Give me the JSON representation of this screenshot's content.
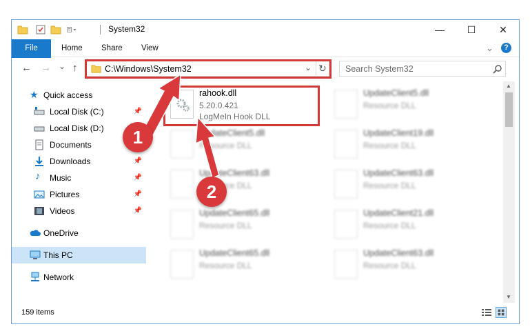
{
  "window": {
    "title": "System32",
    "minimize": "—",
    "maximize": "☐",
    "close": "✕"
  },
  "ribbon": {
    "tabs": [
      "File",
      "Home",
      "Share",
      "View"
    ],
    "help": "?",
    "collapse": "⌄"
  },
  "nav": {
    "back": "←",
    "forward": "→",
    "dropdown": "⌄",
    "up": "↑"
  },
  "address": {
    "path": "C:\\Windows\\System32",
    "dropdown": "⌄",
    "refresh": "↻"
  },
  "search": {
    "placeholder": "Search System32",
    "icon": "search-icon"
  },
  "sidebar": {
    "items": [
      {
        "label": "Quick access",
        "icon": "star-icon",
        "pinned": false
      },
      {
        "label": "Local Disk (C:)",
        "icon": "drive-icon",
        "pinned": true
      },
      {
        "label": "Local Disk (D:)",
        "icon": "drive-icon",
        "pinned": false
      },
      {
        "label": "Documents",
        "icon": "documents-icon",
        "pinned": true
      },
      {
        "label": "Downloads",
        "icon": "download-icon",
        "pinned": true
      },
      {
        "label": "Music",
        "icon": "music-icon",
        "pinned": true
      },
      {
        "label": "Pictures",
        "icon": "pictures-icon",
        "pinned": true
      },
      {
        "label": "Videos",
        "icon": "videos-icon",
        "pinned": true
      },
      {
        "label": "OneDrive",
        "icon": "cloud-icon",
        "pinned": false
      },
      {
        "label": "This PC",
        "icon": "computer-icon",
        "pinned": false,
        "selected": true
      },
      {
        "label": "Network",
        "icon": "network-icon",
        "pinned": false
      }
    ],
    "pin_glyph": "📌"
  },
  "files": [
    {
      "name": "rahook.dll",
      "version": "5.20.0.421",
      "description": "LogMeIn Hook DLL",
      "highlighted": true
    },
    {
      "name": "UpdateClient5.dll",
      "description": "Resource DLL"
    },
    {
      "name": "UpdateClient5.dll",
      "description": "Resource DLL"
    },
    {
      "name": "UpdateClient19.dll",
      "description": "Resource DLL"
    },
    {
      "name": "UpdateClient63.dll",
      "description": "Resource DLL"
    },
    {
      "name": "UpdateClient63.dll",
      "description": "Resource DLL"
    },
    {
      "name": "UpdateClient65.dll",
      "description": "Resource DLL"
    },
    {
      "name": "UpdateClient21.dll",
      "description": "Resource DLL"
    },
    {
      "name": "UpdateClient65.dll",
      "description": "Resource DLL"
    },
    {
      "name": "UpdateClient63.dll",
      "description": "Resource DLL"
    }
  ],
  "status": {
    "item_count": "159 items"
  },
  "annotations": {
    "step1": "1",
    "step2": "2",
    "color": "#d9393a"
  }
}
